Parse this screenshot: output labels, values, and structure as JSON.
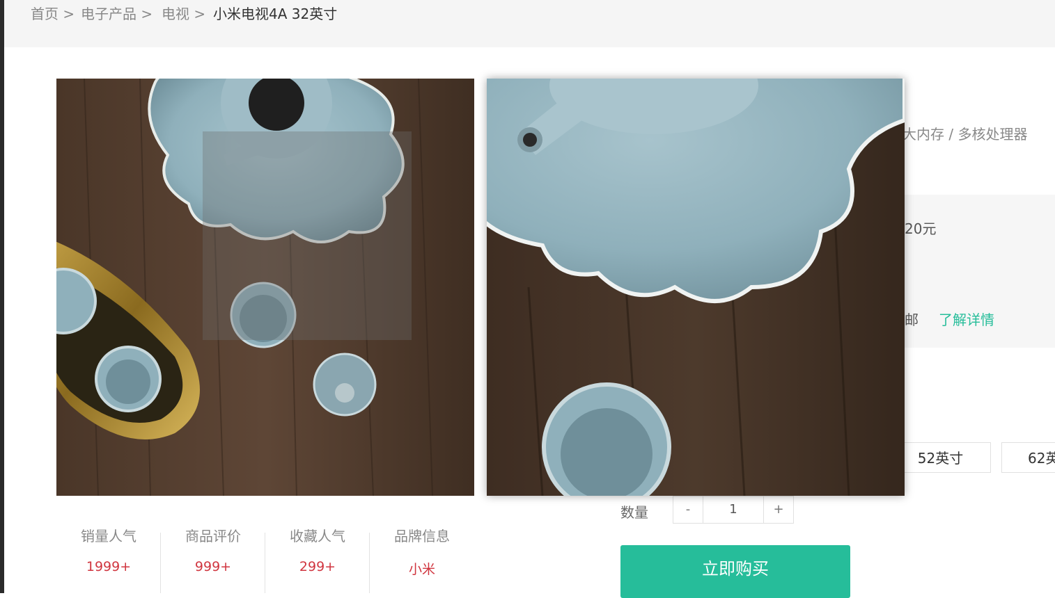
{
  "breadcrumb": {
    "items": [
      "首页 >",
      "电子产品 >",
      "电视 >"
    ],
    "current": "小米电视4A 32英寸"
  },
  "product": {
    "subtitle_partial": "大内存 / 多核处理器",
    "price_partial": "20元",
    "shipping_partial": "邮",
    "details_link": "了解详情"
  },
  "sizes": [
    "52英寸",
    "62英"
  ],
  "quantity": {
    "label": "数量",
    "minus": "-",
    "value": "1",
    "plus": "+"
  },
  "buy_button": "立即购买",
  "stats": [
    {
      "label": "销量人气",
      "value": "1999+"
    },
    {
      "label": "商品评价",
      "value": "999+"
    },
    {
      "label": "收藏人气",
      "value": "299+"
    },
    {
      "label": "品牌信息",
      "value": "小米"
    }
  ],
  "colors": {
    "accent": "#26bd9a",
    "stat_value": "#d0353f"
  }
}
